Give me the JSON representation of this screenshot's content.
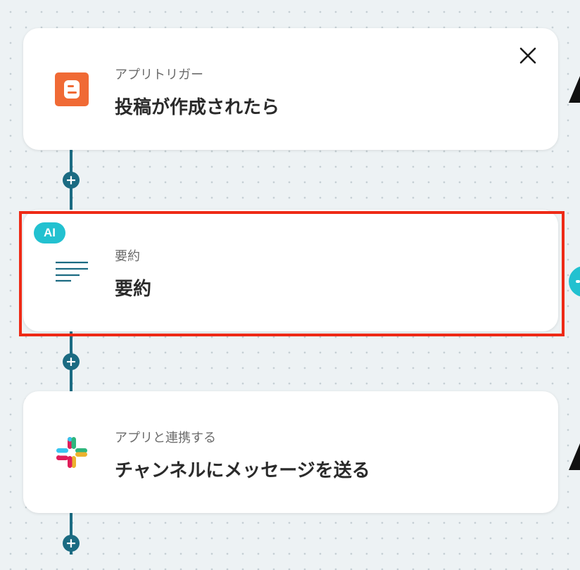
{
  "steps": [
    {
      "subtitle": "アプリトリガー",
      "title": "投稿が作成されたら",
      "icon": "blogger-icon",
      "color": "#f06a35"
    },
    {
      "badge": "AI",
      "subtitle": "要約",
      "title": "要約",
      "icon": "summary-lines-icon",
      "color": "#1b6b82"
    },
    {
      "subtitle": "アプリと連携する",
      "title": "チャンネルにメッセージを送る",
      "icon": "slack-icon"
    }
  ],
  "add_step_symbol": "+",
  "close_icon": "close-icon",
  "colors": {
    "accent": "#1b6b82",
    "highlight": "#ee2a16",
    "ai_badge": "#22c1d0",
    "background": "#edf2f4"
  }
}
